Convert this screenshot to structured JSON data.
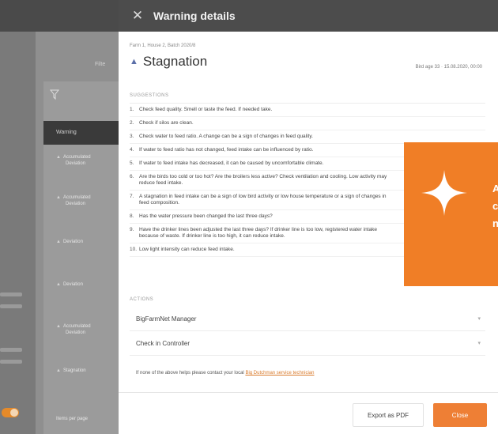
{
  "background": {
    "filter_icon": "filter-icon",
    "list_header": "Warning",
    "rows": [
      {
        "title": "Accumulated",
        "subtitle": "Deviation",
        "icon": "triangle-icon"
      },
      {
        "title": "Accumulated",
        "subtitle": "Deviation",
        "icon": "triangle-icon"
      },
      {
        "title": "Deviation",
        "subtitle": "",
        "icon": "triangle-icon"
      },
      {
        "title": "Deviation",
        "subtitle": "",
        "icon": "triangle-icon"
      },
      {
        "title": "Accumulated",
        "subtitle": "Deviation",
        "icon": "triangle-icon"
      },
      {
        "title": "Stagnation",
        "subtitle": "",
        "icon": "triangle-icon"
      }
    ],
    "footer": "Items per page"
  },
  "dialog": {
    "title": "Warning details",
    "close_icon": "close-icon",
    "breadcrumb": "Farm 1, House 2, Batch 2020/8",
    "warning_title": "Stagnation",
    "bird_age": "Bird age 33  ·  15.08.2020, 00:00",
    "suggestions_label": "SUGGESTIONS",
    "suggestions": [
      {
        "num": "1.",
        "text": "Check feed quality. Smell or taste the feed. If needed take."
      },
      {
        "num": "2.",
        "text": "Check if silos are clean."
      },
      {
        "num": "3.",
        "text": "Check water to feed ratio. A change can be a sign of changes in feed quality."
      },
      {
        "num": "4.",
        "text": "If water to feed ratio has not changed, feed intake can be influenced by ratio."
      },
      {
        "num": "5.",
        "text": "If water to feed intake has decreased, it can be caused by uncomfortable climate."
      },
      {
        "num": "6.",
        "text": "Are the birds too cold or too hot? Are the broilers less active? Check ventilation and cooling. Low activity may reduce feed intake."
      },
      {
        "num": "7.",
        "text": "A stagnation in feed intake can be a sign of low bird activity or low house temperature or a sign of changes in feed composition."
      },
      {
        "num": "8.",
        "text": "Has the water pressure been changed the last three days?"
      },
      {
        "num": "9.",
        "text": "Have the drinker lines been adjusted the last three days? If drinker line is too low, registered water intake because of waste. If drinker line is too high, it can reduce intake."
      },
      {
        "num": "10.",
        "text": "Low light intensity can reduce feed intake."
      }
    ],
    "actions_label": "ACTIONS",
    "actions": [
      {
        "label": "BigFarmNet Manager"
      },
      {
        "label": "Check in Controller"
      }
    ],
    "contact_prefix": "If none of the above helps please contact your local ",
    "contact_link": "Big Dutchman service technician",
    "export_label": "Export as PDF",
    "close_label": "Close"
  },
  "promo": {
    "icon": "sparkle-icon",
    "lines": [
      "A",
      "c",
      "n"
    ],
    "color": "#f07e26"
  }
}
